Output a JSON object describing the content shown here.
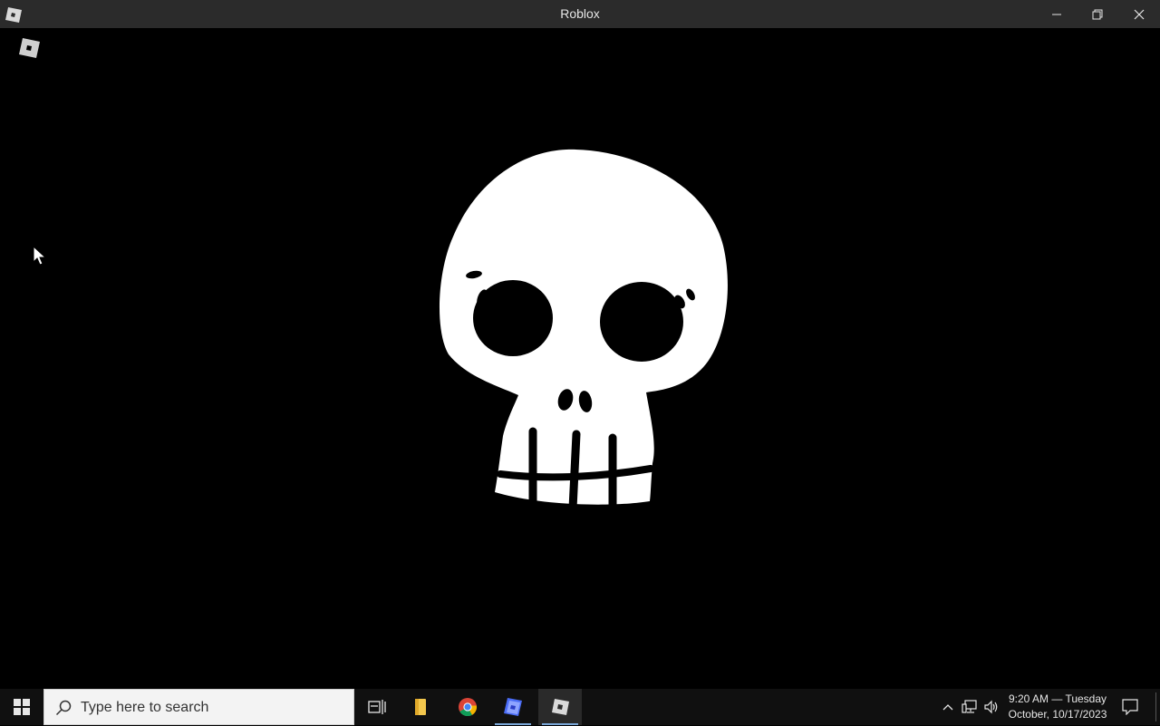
{
  "window": {
    "title": "Roblox",
    "icons": {
      "app": "roblox-logo-icon",
      "minimize": "minimize-icon",
      "maximize": "restore-icon",
      "close": "close-icon"
    }
  },
  "content": {
    "corner_icon": "roblox-logo-icon",
    "splash_icon": "skull-icon",
    "background_color": "#000000"
  },
  "taskbar": {
    "search": {
      "placeholder": "Type here to search"
    },
    "pinned": [
      {
        "name": "task-view-icon"
      },
      {
        "name": "file-explorer-icon"
      },
      {
        "name": "chrome-icon"
      },
      {
        "name": "roblox-studio-icon"
      },
      {
        "name": "roblox-icon"
      }
    ],
    "clock": {
      "line1": "9:20 AM — Tuesday",
      "line2": "October, 10/17/2023"
    }
  }
}
